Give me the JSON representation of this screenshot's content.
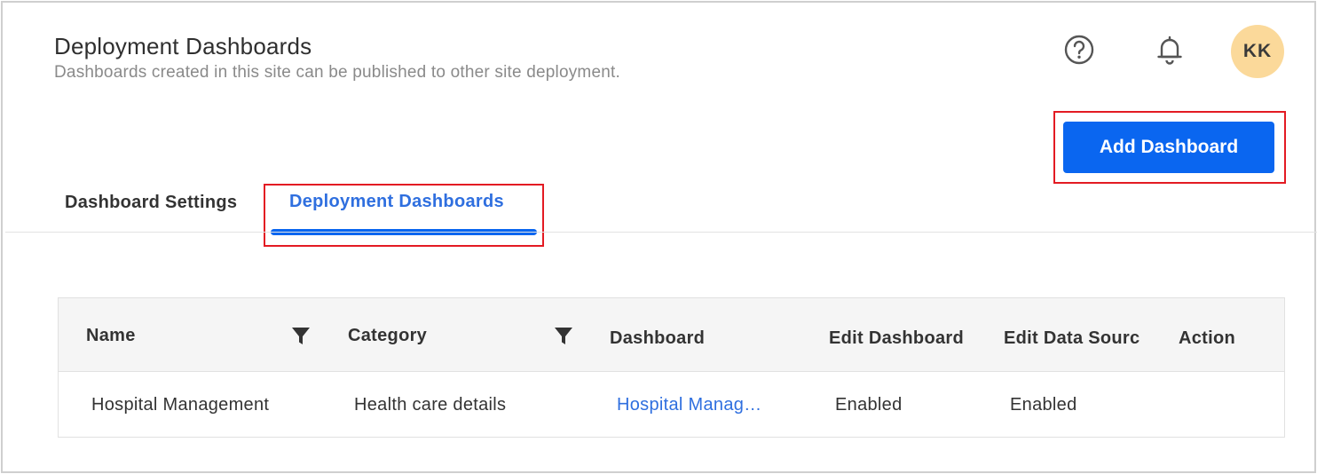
{
  "header": {
    "title": "Deployment Dashboards",
    "subtitle": "Dashboards created in this site can be published to other site deployment.",
    "avatar_initials": "KK",
    "icons": [
      "help-icon",
      "bell-icon"
    ]
  },
  "toolbar": {
    "add_dashboard_label": "Add Dashboard"
  },
  "tabs": [
    {
      "label": "Dashboard Settings",
      "active": false
    },
    {
      "label": "Deployment Dashboards",
      "active": true
    }
  ],
  "table": {
    "columns": [
      "Name",
      "Category",
      "Dashboard",
      "Edit Dashboard",
      "Edit Data Sourc",
      "Action"
    ],
    "rows": [
      {
        "name": "Hospital Management",
        "category": "Health care details",
        "dashboard": "Hospital Manag…",
        "edit_dashboard": "Enabled",
        "edit_data_source": "Enabled",
        "action": ""
      }
    ]
  },
  "colors": {
    "accent": "#0a66f0",
    "active_tab_text": "#2f6fdf",
    "highlight_border": "#e31b23",
    "avatar_bg": "#fbd99a",
    "header_row_bg": "#f5f5f5"
  }
}
